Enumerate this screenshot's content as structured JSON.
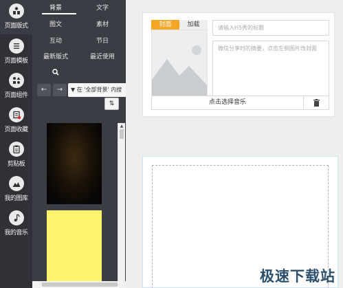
{
  "rail": {
    "items": [
      {
        "label": "页面版式",
        "icon": "layout-icon"
      },
      {
        "label": "页面模板",
        "icon": "list-icon"
      },
      {
        "label": "页面组件",
        "icon": "components-icon"
      },
      {
        "label": "页面收藏",
        "icon": "favorites-icon"
      },
      {
        "label": "剪贴板",
        "icon": "clipboard-icon"
      },
      {
        "label": "我的图库",
        "icon": "gallery-icon"
      },
      {
        "label": "我的音乐",
        "icon": "music-icon"
      }
    ]
  },
  "panel": {
    "tabs": [
      "背景",
      "文字",
      "图文",
      "素材",
      "互动",
      "节日",
      "最新版式",
      "最近使用"
    ],
    "filter_text": "在 '全部背景' 内搜",
    "prev_icon": "arrow-left-icon",
    "next_icon": "arrow-right-icon",
    "sort_icon": "sort-icon"
  },
  "editor": {
    "cover_tab": "封面",
    "load_tab": "加载",
    "title_placeholder": "请输入H5秀的标题",
    "desc_placeholder": "微信分享时的摘要，点击左侧图片改封面",
    "music_button": "点击选择音乐",
    "trash_icon": "trash-icon"
  },
  "watermark": "极速下载站",
  "colors": {
    "accent": "#f5a623",
    "rail_bg": "#2f3136",
    "panel_bg": "#3a3d43",
    "thumb_yellow": "#fff36e"
  }
}
